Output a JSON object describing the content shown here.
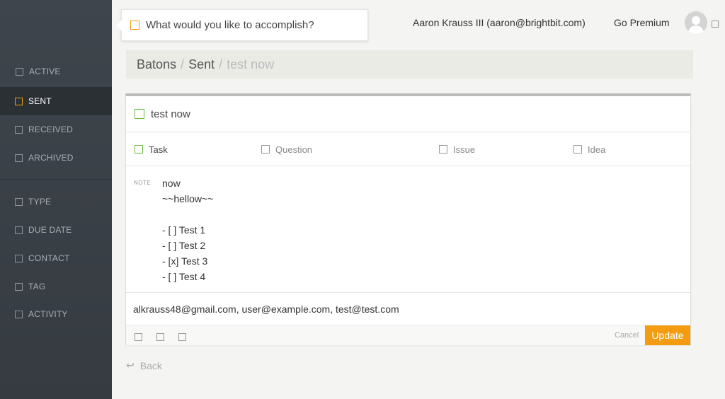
{
  "sidebar": {
    "items": [
      {
        "label": "ACTIVE"
      },
      {
        "label": "SENT"
      },
      {
        "label": "RECEIVED"
      },
      {
        "label": "ARCHIVED"
      }
    ],
    "filters": [
      {
        "label": "TYPE"
      },
      {
        "label": "DUE DATE"
      },
      {
        "label": "CONTACT"
      },
      {
        "label": "TAG"
      },
      {
        "label": "ACTIVITY"
      }
    ]
  },
  "goal": {
    "text": "What would you like to accomplish?"
  },
  "header": {
    "user": "Aaron Krauss III (aaron@brightbit.com)",
    "premium": "Go Premium"
  },
  "breadcrumb": {
    "crumb1": "Batons",
    "crumb2": "Sent",
    "current": "test now",
    "sep": "/"
  },
  "card": {
    "title": "test now",
    "types": [
      {
        "label": "Task"
      },
      {
        "label": "Question"
      },
      {
        "label": "Issue"
      },
      {
        "label": "Idea"
      }
    ],
    "note_label": "NOTE",
    "note_lines": [
      "now",
      "~~hellow~~",
      "",
      "- [ ] Test 1",
      "- [ ] Test 2",
      "- [x] Test 3",
      "- [ ] Test 4"
    ],
    "recipients": "alkrauss48@gmail.com, user@example.com, test@test.com",
    "cancel": "Cancel",
    "update": "Update"
  },
  "back": {
    "arrow": "↩",
    "label": "Back"
  },
  "colors": {
    "accent": "#f39c12",
    "green": "#6cbd45",
    "sidebar": "#3a4046"
  }
}
